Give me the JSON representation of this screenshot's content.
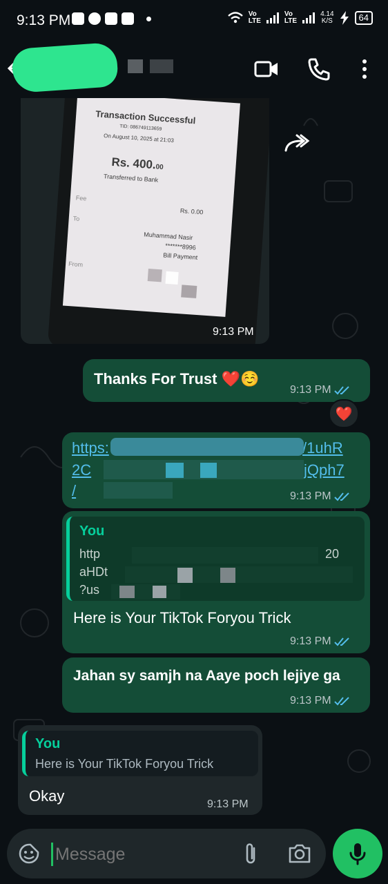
{
  "status_bar": {
    "time": "9:13 PM",
    "volte1": "Vo",
    "lte1": "LTE",
    "volte2": "Vo",
    "lte2": "LTE",
    "speed_value": "4.14",
    "speed_unit": "K/S",
    "battery": "64"
  },
  "header": {
    "contact_name": ""
  },
  "messages": {
    "photo": {
      "time": "9:13 PM",
      "receipt": {
        "title": "Transaction Successful",
        "tid": "TID: 086749113659",
        "date": "On August 10, 2025 at 21:03",
        "amount": "Rs. 400.",
        "amount_cents": "00",
        "transferred": "Transferred to Bank",
        "fee_label": "Fee",
        "fee_value": "Rs. 0.00",
        "to_label": "To",
        "to_name": "Muhammad Nasir",
        "to_account": "*******8996",
        "to_type": "Bill Payment",
        "from_label": "From"
      }
    },
    "thanks": {
      "text": "Thanks For Trust ❤️☺️",
      "time": "9:13 PM",
      "reaction": "❤️"
    },
    "link": {
      "line1": "https:",
      "line1_end": "/1uhR",
      "line2": "2C",
      "line2_end": "jQph7",
      "line3": "/",
      "time": "9:13 PM"
    },
    "trick": {
      "quote_author": "You",
      "quote_line1": "http",
      "quote_line1_end": "20",
      "quote_line2": "aHDt",
      "quote_line3": "?us",
      "text": "Here is Your TikTok Foryou Trick",
      "time": "9:13 PM"
    },
    "jahan": {
      "text": "Jahan sy samjh na Aaye poch lejiye ga",
      "time": "9:13 PM"
    },
    "okay": {
      "quote_author": "You",
      "quote_text": "Here is Your TikTok Foryou Trick",
      "text": "Okay",
      "time": "9:13 PM"
    }
  },
  "input": {
    "placeholder": "Message"
  },
  "colors": {
    "outgoing": "#144d37",
    "incoming": "#1f272a",
    "accent": "#21c063",
    "link": "#53bdeb",
    "quote_author": "#06cf9c"
  },
  "icons": [
    "back-arrow-icon",
    "video-call-icon",
    "voice-call-icon",
    "more-options-icon",
    "forward-icon",
    "read-ticks-icon",
    "emoji-sticker-icon",
    "attach-icon",
    "camera-icon",
    "mic-icon"
  ]
}
